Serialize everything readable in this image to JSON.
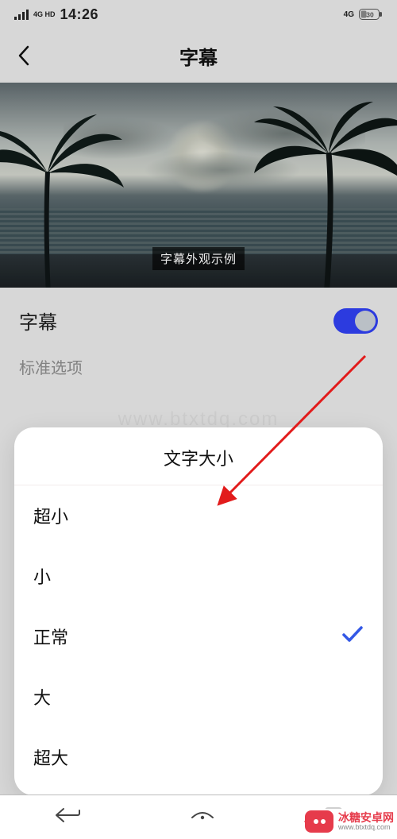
{
  "status": {
    "network_label": "4G HD",
    "time": "14:26",
    "net_right": "4G",
    "battery": "30"
  },
  "header": {
    "title": "字幕"
  },
  "preview": {
    "caption": "字幕外观示例"
  },
  "settings": {
    "subtitle_label": "字幕",
    "subtitle_on": true,
    "standard_options_label": "标准选项"
  },
  "sheet": {
    "title": "文字大小",
    "options": [
      {
        "label": "超小",
        "selected": false
      },
      {
        "label": "小",
        "selected": false
      },
      {
        "label": "正常",
        "selected": true
      },
      {
        "label": "大",
        "selected": false
      },
      {
        "label": "超大",
        "selected": false
      }
    ]
  },
  "watermark": {
    "text": "冰糖安卓网",
    "site": "www.btxtdq.com",
    "center": "www.btxtdq.com"
  }
}
